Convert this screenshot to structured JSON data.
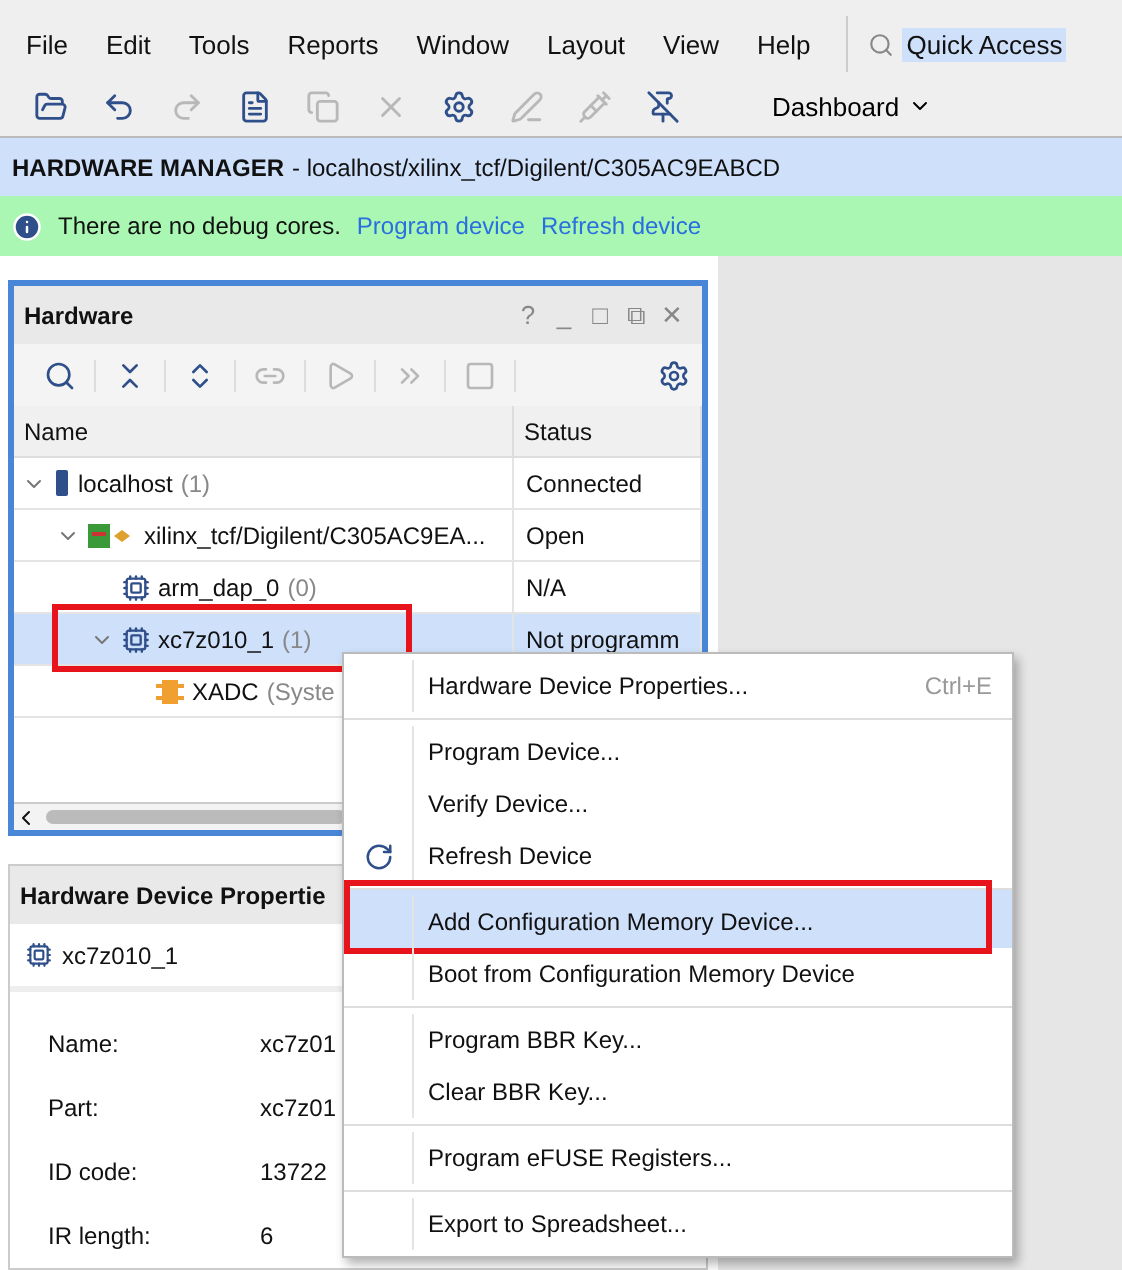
{
  "menu_bar": {
    "items": [
      "File",
      "Edit",
      "Tools",
      "Reports",
      "Window",
      "Layout",
      "View",
      "Help"
    ],
    "quick_access": {
      "value": "Quick Access"
    }
  },
  "toolbar": {
    "buttons": [
      {
        "kind": "open",
        "disabled": false
      },
      {
        "kind": "undo",
        "disabled": false
      },
      {
        "kind": "redo",
        "disabled": true
      },
      {
        "kind": "document",
        "disabled": false
      },
      {
        "kind": "copy",
        "disabled": true
      },
      {
        "kind": "delete",
        "disabled": true
      },
      {
        "kind": "settings",
        "disabled": false
      },
      {
        "kind": "pen",
        "disabled": true
      },
      {
        "kind": "probe",
        "disabled": true
      },
      {
        "kind": "unpin",
        "disabled": false
      }
    ],
    "layout_menu": "Dashboard"
  },
  "header": {
    "title": "HARDWARE MANAGER",
    "path": "- localhost/xilinx_tcf/Digilent/C305AC9EABCD"
  },
  "info_bar": {
    "message": "There are no debug cores.",
    "links": [
      "Program device",
      "Refresh device"
    ]
  },
  "hardware_panel": {
    "title": "Hardware",
    "controls": [
      "?",
      "_",
      "□",
      "⧉",
      "✕"
    ],
    "tools": [
      {
        "kind": "search",
        "disabled": false
      },
      {
        "kind": "collapse",
        "disabled": false
      },
      {
        "kind": "expand",
        "disabled": false
      },
      {
        "kind": "link",
        "disabled": true
      },
      {
        "kind": "run",
        "disabled": true
      },
      {
        "kind": "fast",
        "disabled": true
      },
      {
        "kind": "stop",
        "disabled": true
      }
    ],
    "columns": [
      "Name",
      "Status"
    ],
    "tree": [
      {
        "kind": "host",
        "name": "localhost",
        "count": "(1)",
        "status": "Connected",
        "expanded": true,
        "selected": false,
        "callout": false,
        "children": [
          {
            "kind": "target",
            "name": "xilinx_tcf/Digilent/C305AC9EA...",
            "status": "Open",
            "expanded": true,
            "selected": false,
            "callout": false,
            "children": [
              {
                "kind": "chip",
                "name": "arm_dap_0",
                "count": "(0)",
                "status": "N/A",
                "selected": false,
                "callout": false
              },
              {
                "kind": "chip",
                "name": "xc7z010_1",
                "count": "(1)",
                "status": "Not programm",
                "expanded": true,
                "selected": true,
                "callout": true,
                "children": [
                  {
                    "kind": "xadc",
                    "name": "XADC",
                    "count": "(Syste",
                    "selected": false,
                    "callout": false
                  }
                ]
              }
            ]
          }
        ]
      }
    ]
  },
  "properties_panel": {
    "title": "Hardware Device Propertie",
    "device": "xc7z010_1",
    "rows": [
      {
        "label": "Name:",
        "value": "xc7z01"
      },
      {
        "label": "Part:",
        "value": "xc7z01"
      },
      {
        "label": "ID code:",
        "value": "13722"
      },
      {
        "label": "IR length:",
        "value": "6"
      }
    ]
  },
  "context_menu": {
    "items": [
      {
        "label": "Hardware Device Properties...",
        "shortcut": "Ctrl+E",
        "separator_before": false,
        "selected": false,
        "callout": false
      },
      {
        "label": "Program Device...",
        "separator_before": true,
        "selected": false,
        "callout": false
      },
      {
        "label": "Verify Device...",
        "separator_before": false,
        "selected": false,
        "callout": false
      },
      {
        "label": "Refresh Device",
        "kind": "refresh",
        "separator_before": false,
        "selected": false,
        "callout": false
      },
      {
        "label": "Add Configuration Memory Device...",
        "separator_before": true,
        "selected": true,
        "callout": true
      },
      {
        "label": "Boot from Configuration Memory Device",
        "separator_before": false,
        "selected": false,
        "callout": false
      },
      {
        "label": "Program BBR Key...",
        "separator_before": true,
        "selected": false,
        "callout": false
      },
      {
        "label": "Clear BBR Key...",
        "separator_before": false,
        "selected": false,
        "callout": false
      },
      {
        "label": "Program eFUSE Registers...",
        "separator_before": true,
        "selected": false,
        "callout": false
      },
      {
        "label": "Export to Spreadsheet...",
        "separator_before": true,
        "selected": false,
        "callout": false
      }
    ]
  }
}
